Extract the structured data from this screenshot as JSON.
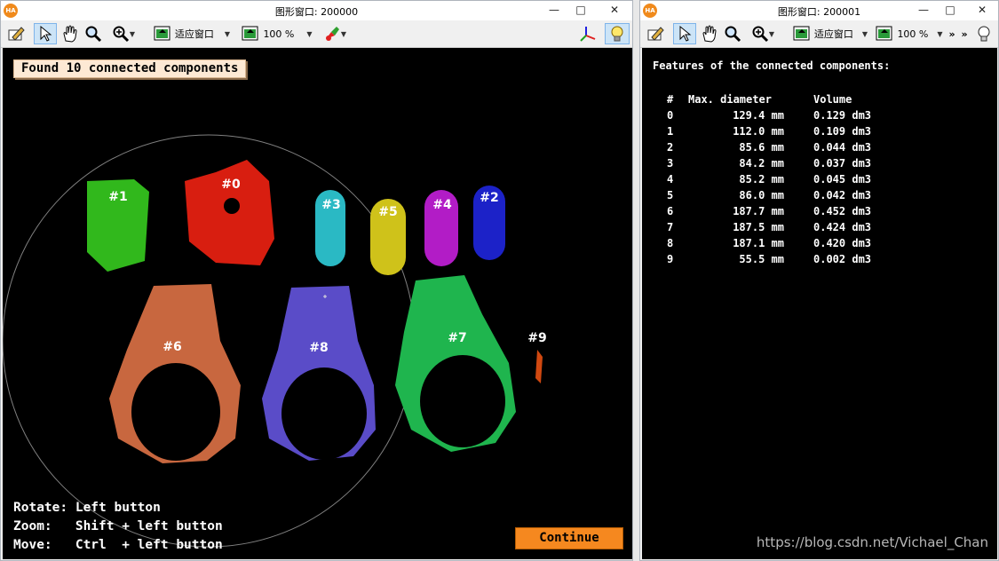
{
  "left_window": {
    "title": "图形窗口: 200000",
    "toolbar": {
      "fit_label": "适应窗口",
      "zoom_label": "100 %"
    },
    "found_label": "Found 10 connected components",
    "help_lines": [
      "Rotate: Left button",
      "Zoom:   Shift + left button",
      "Move:   Ctrl  + left button"
    ],
    "continue_label": "Continue",
    "component_labels": [
      "#0",
      "#1",
      "#2",
      "#3",
      "#4",
      "#5",
      "#6",
      "#7",
      "#8",
      "#9"
    ],
    "component_colors": {
      "c0": "#d81e10",
      "c1": "#31b81c",
      "c2": "#1c22c8",
      "c3": "#2ab9c4",
      "c4": "#b21cc6",
      "c5": "#cfc21a",
      "c6": "#c8673f",
      "c7": "#1fb54e",
      "c8": "#5a4cc8",
      "c9": "#d04810"
    }
  },
  "right_window": {
    "title": "图形窗口: 200001",
    "toolbar": {
      "fit_label": "适应窗口",
      "zoom_label": "100 %",
      "overflow_label": "»"
    },
    "features_title": "Features of the connected components:",
    "table": {
      "headers": [
        "#",
        "Max. diameter",
        "Volume"
      ],
      "rows": [
        {
          "id": "0",
          "diameter": "129.4 mm",
          "volume": "0.129 dm3"
        },
        {
          "id": "1",
          "diameter": "112.0 mm",
          "volume": "0.109 dm3"
        },
        {
          "id": "2",
          "diameter": "85.6 mm",
          "volume": "0.044 dm3"
        },
        {
          "id": "3",
          "diameter": "84.2 mm",
          "volume": "0.037 dm3"
        },
        {
          "id": "4",
          "diameter": "85.2 mm",
          "volume": "0.045 dm3"
        },
        {
          "id": "5",
          "diameter": "86.0 mm",
          "volume": "0.042 dm3"
        },
        {
          "id": "6",
          "diameter": "187.7 mm",
          "volume": "0.452 dm3"
        },
        {
          "id": "7",
          "diameter": "187.5 mm",
          "volume": "0.424 dm3"
        },
        {
          "id": "8",
          "diameter": "187.1 mm",
          "volume": "0.420 dm3"
        },
        {
          "id": "9",
          "diameter": "55.5 mm",
          "volume": "0.002 dm3"
        }
      ]
    }
  },
  "watermark": "https://blog.csdn.net/Vichael_Chan",
  "icons": [
    "halcon-app-icon",
    "pencil-icon",
    "pointer-icon",
    "hand-icon",
    "magnifier-icon",
    "zoom-in-icon",
    "fit-window-icon",
    "zoom-percent-icon",
    "paint-icon",
    "axis-icon",
    "bulb-icon",
    "minimize-icon",
    "maximize-icon",
    "close-icon"
  ]
}
